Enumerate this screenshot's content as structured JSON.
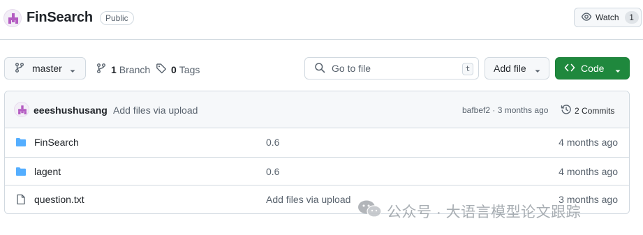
{
  "repo": {
    "name": "FinSearch",
    "visibility": "Public",
    "watch_label": "Watch",
    "watch_count": "1"
  },
  "toolbar": {
    "branch": "master",
    "branch_count": "1",
    "branch_label": "Branch",
    "tag_count": "0",
    "tag_label": "Tags",
    "search_placeholder": "Go to file",
    "search_shortcut": "t",
    "add_file_label": "Add file",
    "code_label": "Code"
  },
  "commit": {
    "author": "eeeshushusang",
    "message": "Add files via upload",
    "meta": "bafbef2 · 3 months ago",
    "commits_label": "2 Commits"
  },
  "files": [
    {
      "icon": "folder-icon",
      "name": "FinSearch",
      "message": "0.6",
      "date": "4 months ago"
    },
    {
      "icon": "folder-icon",
      "name": "lagent",
      "message": "0.6",
      "date": "4 months ago"
    },
    {
      "icon": "file-icon",
      "name": "question.txt",
      "message": "Add files via upload",
      "date": "3 months ago"
    }
  ],
  "watermark": {
    "text": "公众号 · 大语言模型论文跟踪",
    "icon": "wechat-icon"
  },
  "colors": {
    "primary_button": "#1f883d",
    "folder": "#54aeff",
    "border": "#d1d9e0",
    "muted_text": "#59636e"
  }
}
